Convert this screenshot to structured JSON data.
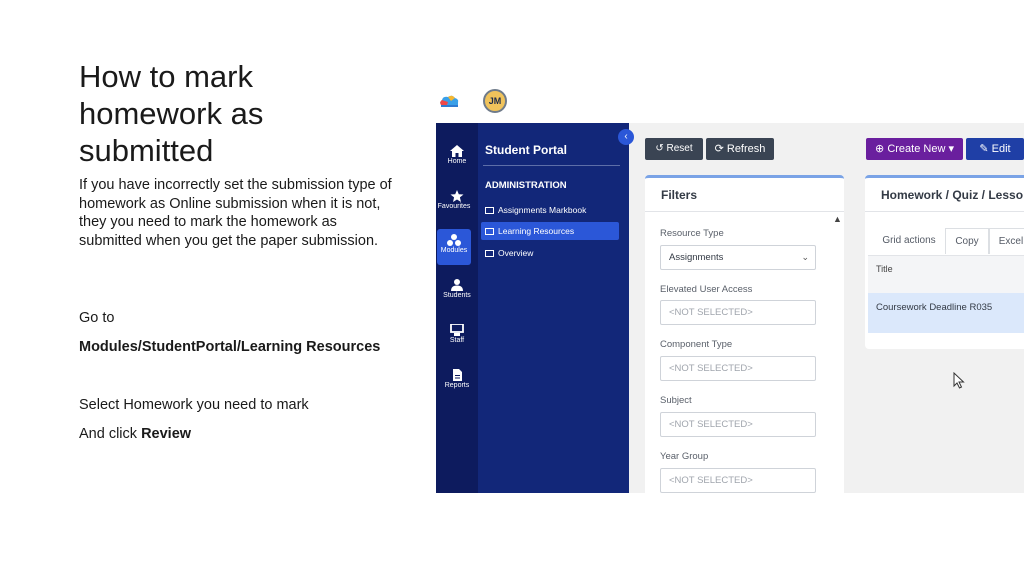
{
  "slide": {
    "title": "How to mark homework as submitted",
    "intro": "If you have incorrectly set the submission type of homework as Online submission when it is not, they you need to mark the homework as submitted when you get the paper submission.",
    "go_to": "Go to",
    "path": "Modules/StudentPortal/Learning Resources",
    "select_text": "Select Homework you need to mark",
    "click_prefix": "And click ",
    "click_target": "Review"
  },
  "app": {
    "avatar_initials": "JM",
    "rail": [
      {
        "label": "Home",
        "icon": "home-icon"
      },
      {
        "label": "Favourites",
        "icon": "star-icon"
      },
      {
        "label": "Modules",
        "icon": "modules-icon",
        "active": true
      },
      {
        "label": "Students",
        "icon": "user-icon"
      },
      {
        "label": "Staff",
        "icon": "staff-icon"
      },
      {
        "label": "Reports",
        "icon": "document-icon"
      }
    ],
    "nav": {
      "title": "Student Portal",
      "section": "ADMINISTRATION",
      "items": [
        {
          "label": "Assignments Markbook"
        },
        {
          "label": "Learning Resources",
          "active": true
        },
        {
          "label": "Overview"
        }
      ],
      "collapse_glyph": "‹"
    },
    "toolbar": {
      "reset": "Reset",
      "refresh": "Refresh",
      "create_new": "Create New",
      "edit": "Edit"
    },
    "filters": {
      "title": "Filters",
      "fields": [
        {
          "label": "Resource Type",
          "value": "Assignments",
          "type": "select"
        },
        {
          "label": "Elevated User Access",
          "value": "<NOT SELECTED>"
        },
        {
          "label": "Component Type",
          "value": "<NOT SELECTED>"
        },
        {
          "label": "Subject",
          "value": "<NOT SELECTED>"
        },
        {
          "label": "Year Group",
          "value": "<NOT SELECTED>"
        }
      ]
    },
    "grid": {
      "title": "Homework / Quiz / Lesso",
      "tabs": [
        "Grid actions",
        "Copy",
        "Excel"
      ],
      "column": "Title",
      "row": "Coursework Deadline R035"
    },
    "colors": {
      "rail": "#0d1b5e",
      "nav": "#122779",
      "active": "#2b57d8",
      "create_button": "#6a1f9e",
      "edit_button": "#1f3fa6",
      "selected_row": "#dbe8fb"
    }
  }
}
